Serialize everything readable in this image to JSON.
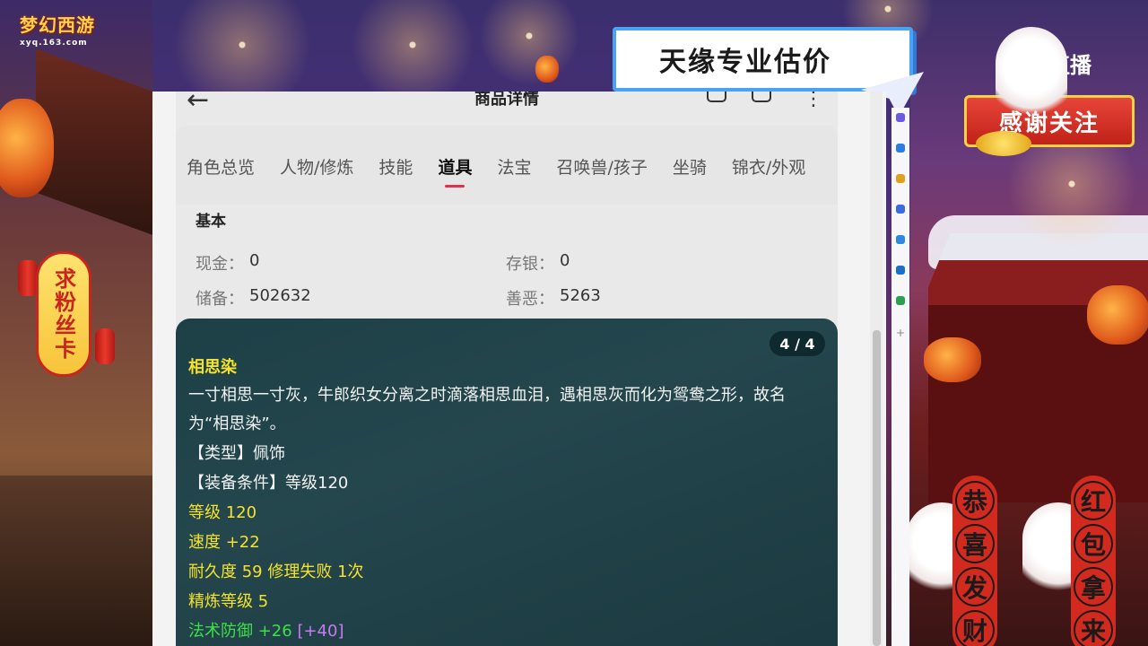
{
  "overlay": {
    "logo_text": "梦幻西游",
    "logo_sub": "xyq.163.com",
    "banner_text": "天缘专业估价",
    "live_brand": "直播",
    "thanks_text": "感谢关注",
    "fans_badge": "求粉丝卡",
    "scroll_left": [
      "恭",
      "喜",
      "发",
      "财"
    ],
    "scroll_right": [
      "红",
      "包",
      "拿",
      "来"
    ]
  },
  "app": {
    "page_title": "商品详情",
    "tabs": [
      {
        "label": "角色总览",
        "active": false
      },
      {
        "label": "人物/修炼",
        "active": false
      },
      {
        "label": "技能",
        "active": false
      },
      {
        "label": "道具",
        "active": true
      },
      {
        "label": "法宝",
        "active": false
      },
      {
        "label": "召唤兽/孩子",
        "active": false
      },
      {
        "label": "坐骑",
        "active": false
      },
      {
        "label": "锦衣/外观",
        "active": false
      }
    ],
    "section_title": "基本",
    "fields": [
      {
        "label": "现金：",
        "value": "0"
      },
      {
        "label": "存银：",
        "value": "0"
      },
      {
        "label": "储备：",
        "value": "502632"
      },
      {
        "label": "善恶：",
        "value": "5263"
      }
    ]
  },
  "tooltip": {
    "counter": "4 / 4",
    "name": "相思染",
    "description": "一寸相思一寸灰，牛郎织女分离之时滴落相思血泪，遇相思灰而化为鸳鸯之形，故名为“相思染”。",
    "type_line": "【类型】佩饰",
    "condition_line": "【装备条件】等级120",
    "level_line": "等级 120",
    "speed_line": "速度 +22",
    "durability_line": "耐久度 59 修理失败 1次",
    "refine_line": "精炼等级 5",
    "magic_def_label": "法术防御 +26",
    "magic_def_bonus": "[+40]"
  }
}
